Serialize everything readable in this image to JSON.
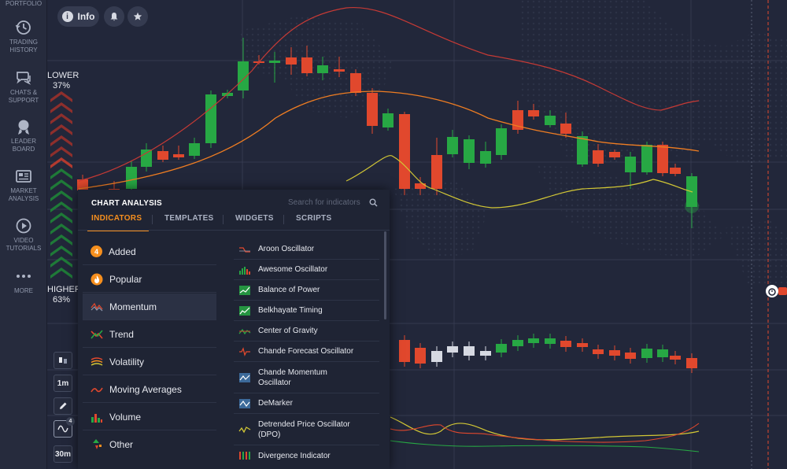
{
  "nav": {
    "portfolio": "PORTFOLIO",
    "items": [
      {
        "line1": "TRADING",
        "line2": "HISTORY",
        "icon": "history-icon"
      },
      {
        "line1": "CHATS &",
        "line2": "SUPPORT",
        "icon": "chat-icon"
      },
      {
        "line1": "LEADER",
        "line2": "BOARD",
        "icon": "medal-icon"
      },
      {
        "line1": "MARKET",
        "line2": "ANALYSIS",
        "icon": "newspaper-icon"
      },
      {
        "line1": "VIDEO",
        "line2": "TUTORIALS",
        "icon": "play-icon"
      },
      {
        "line1": "MORE",
        "line2": "",
        "icon": "dots-icon"
      }
    ]
  },
  "topbar": {
    "info_label": "Info"
  },
  "sentiment": {
    "lower_label": "LOWER",
    "lower_pct": "37%",
    "higher_label": "HIGHER",
    "higher_pct": "63%"
  },
  "tools": {
    "timeframe": "1m",
    "badge": "4",
    "expiry": "30m"
  },
  "panel": {
    "title": "CHART ANALYSIS",
    "search_placeholder": "Search for indicators",
    "tabs": [
      "INDICATORS",
      "TEMPLATES",
      "WIDGETS",
      "SCRIPTS"
    ],
    "categories": [
      {
        "label": "Added",
        "badge": "4",
        "icon": "added-count-icon"
      },
      {
        "label": "Popular",
        "icon": "flame-icon"
      },
      {
        "label": "Momentum",
        "icon": "momentum-icon"
      },
      {
        "label": "Trend",
        "icon": "trend-icon"
      },
      {
        "label": "Volatility",
        "icon": "volatility-icon"
      },
      {
        "label": "Moving Averages",
        "icon": "moving-average-icon"
      },
      {
        "label": "Volume",
        "icon": "volume-icon"
      },
      {
        "label": "Other",
        "icon": "other-icon"
      }
    ],
    "indicators": [
      {
        "line1": "Aroon Oscillator",
        "line2": ""
      },
      {
        "line1": "Awesome Oscillator",
        "line2": ""
      },
      {
        "line1": "Balance of Power",
        "line2": ""
      },
      {
        "line1": "Belkhayate Timing",
        "line2": ""
      },
      {
        "line1": "Center of Gravity",
        "line2": ""
      },
      {
        "line1": "Chande Forecast Oscillator",
        "line2": ""
      },
      {
        "line1": "Chande Momentum",
        "line2": "Oscillator"
      },
      {
        "line1": "DeMarker",
        "line2": ""
      },
      {
        "line1": "Detrended Price Oscillator",
        "line2": "(DPO)"
      },
      {
        "line1": "Divergence Indicator",
        "line2": ""
      }
    ]
  },
  "colors": {
    "bull": "#27a844",
    "bear": "#e1482d",
    "upper_band": "#c63a35",
    "mid_band": "#ef7d22",
    "low_band": "#d2c735",
    "accent": "#f68f1e"
  }
}
